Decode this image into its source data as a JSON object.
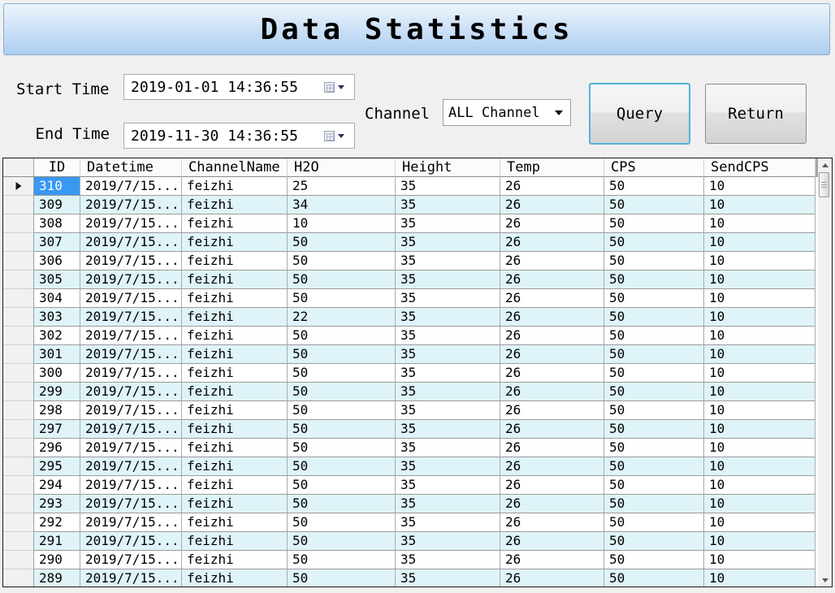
{
  "header": {
    "title": "Data Statistics"
  },
  "filters": {
    "start_time_label": "Start Time",
    "start_time_value": "2019-01-01 14:36:55",
    "end_time_label": "End Time",
    "end_time_value": "2019-11-30 14:36:55",
    "channel_label": "Channel",
    "channel_value": "ALL Channel",
    "query_label": "Query",
    "return_label": "Return"
  },
  "icons": {
    "calendar": "calendar-grid",
    "dropdown_arrow": "chevron-down",
    "scroll_up": "triangle-up",
    "scroll_down": "triangle-down",
    "row_pointer": "triangle-right"
  },
  "colors": {
    "banner_top": "#EDF5FD",
    "banner_bottom": "#AECDF0",
    "banner_border": "#88ABCE",
    "selection_blue": "#3898F2",
    "alt_row_cyan": "#DFF4F8",
    "query_button_border": "#53B4D9",
    "grid_background": "#A5A5A5"
  },
  "table": {
    "columns": [
      "ID",
      "Datetime",
      "ChannelName",
      "H2O",
      "Height",
      "Temp",
      "CPS",
      "SendCPS"
    ],
    "cell_keys": [
      "id",
      "datetime",
      "channel",
      "h2o",
      "height",
      "temp",
      "cps",
      "sendcps"
    ],
    "rows": [
      {
        "id": "310",
        "datetime": "2019/7/15...",
        "channel": "feizhi",
        "h2o": "25",
        "height": "35",
        "temp": "26",
        "cps": "50",
        "sendcps": "10",
        "selected": true
      },
      {
        "id": "309",
        "datetime": "2019/7/15...",
        "channel": "feizhi",
        "h2o": "34",
        "height": "35",
        "temp": "26",
        "cps": "50",
        "sendcps": "10"
      },
      {
        "id": "308",
        "datetime": "2019/7/15...",
        "channel": "feizhi",
        "h2o": "10",
        "height": "35",
        "temp": "26",
        "cps": "50",
        "sendcps": "10"
      },
      {
        "id": "307",
        "datetime": "2019/7/15...",
        "channel": "feizhi",
        "h2o": "50",
        "height": "35",
        "temp": "26",
        "cps": "50",
        "sendcps": "10"
      },
      {
        "id": "306",
        "datetime": "2019/7/15...",
        "channel": "feizhi",
        "h2o": "50",
        "height": "35",
        "temp": "26",
        "cps": "50",
        "sendcps": "10"
      },
      {
        "id": "305",
        "datetime": "2019/7/15...",
        "channel": "feizhi",
        "h2o": "50",
        "height": "35",
        "temp": "26",
        "cps": "50",
        "sendcps": "10"
      },
      {
        "id": "304",
        "datetime": "2019/7/15...",
        "channel": "feizhi",
        "h2o": "50",
        "height": "35",
        "temp": "26",
        "cps": "50",
        "sendcps": "10"
      },
      {
        "id": "303",
        "datetime": "2019/7/15...",
        "channel": "feizhi",
        "h2o": "22",
        "height": "35",
        "temp": "26",
        "cps": "50",
        "sendcps": "10"
      },
      {
        "id": "302",
        "datetime": "2019/7/15...",
        "channel": "feizhi",
        "h2o": "50",
        "height": "35",
        "temp": "26",
        "cps": "50",
        "sendcps": "10"
      },
      {
        "id": "301",
        "datetime": "2019/7/15...",
        "channel": "feizhi",
        "h2o": "50",
        "height": "35",
        "temp": "26",
        "cps": "50",
        "sendcps": "10"
      },
      {
        "id": "300",
        "datetime": "2019/7/15...",
        "channel": "feizhi",
        "h2o": "50",
        "height": "35",
        "temp": "26",
        "cps": "50",
        "sendcps": "10"
      },
      {
        "id": "299",
        "datetime": "2019/7/15...",
        "channel": "feizhi",
        "h2o": "50",
        "height": "35",
        "temp": "26",
        "cps": "50",
        "sendcps": "10"
      },
      {
        "id": "298",
        "datetime": "2019/7/15...",
        "channel": "feizhi",
        "h2o": "50",
        "height": "35",
        "temp": "26",
        "cps": "50",
        "sendcps": "10"
      },
      {
        "id": "297",
        "datetime": "2019/7/15...",
        "channel": "feizhi",
        "h2o": "50",
        "height": "35",
        "temp": "26",
        "cps": "50",
        "sendcps": "10"
      },
      {
        "id": "296",
        "datetime": "2019/7/15...",
        "channel": "feizhi",
        "h2o": "50",
        "height": "35",
        "temp": "26",
        "cps": "50",
        "sendcps": "10"
      },
      {
        "id": "295",
        "datetime": "2019/7/15...",
        "channel": "feizhi",
        "h2o": "50",
        "height": "35",
        "temp": "26",
        "cps": "50",
        "sendcps": "10"
      },
      {
        "id": "294",
        "datetime": "2019/7/15...",
        "channel": "feizhi",
        "h2o": "50",
        "height": "35",
        "temp": "26",
        "cps": "50",
        "sendcps": "10"
      },
      {
        "id": "293",
        "datetime": "2019/7/15...",
        "channel": "feizhi",
        "h2o": "50",
        "height": "35",
        "temp": "26",
        "cps": "50",
        "sendcps": "10"
      },
      {
        "id": "292",
        "datetime": "2019/7/15...",
        "channel": "feizhi",
        "h2o": "50",
        "height": "35",
        "temp": "26",
        "cps": "50",
        "sendcps": "10"
      },
      {
        "id": "291",
        "datetime": "2019/7/15...",
        "channel": "feizhi",
        "h2o": "50",
        "height": "35",
        "temp": "26",
        "cps": "50",
        "sendcps": "10"
      },
      {
        "id": "290",
        "datetime": "2019/7/15...",
        "channel": "feizhi",
        "h2o": "50",
        "height": "35",
        "temp": "26",
        "cps": "50",
        "sendcps": "10"
      },
      {
        "id": "289",
        "datetime": "2019/7/15...",
        "channel": "feizhi",
        "h2o": "50",
        "height": "35",
        "temp": "26",
        "cps": "50",
        "sendcps": "10"
      }
    ]
  }
}
